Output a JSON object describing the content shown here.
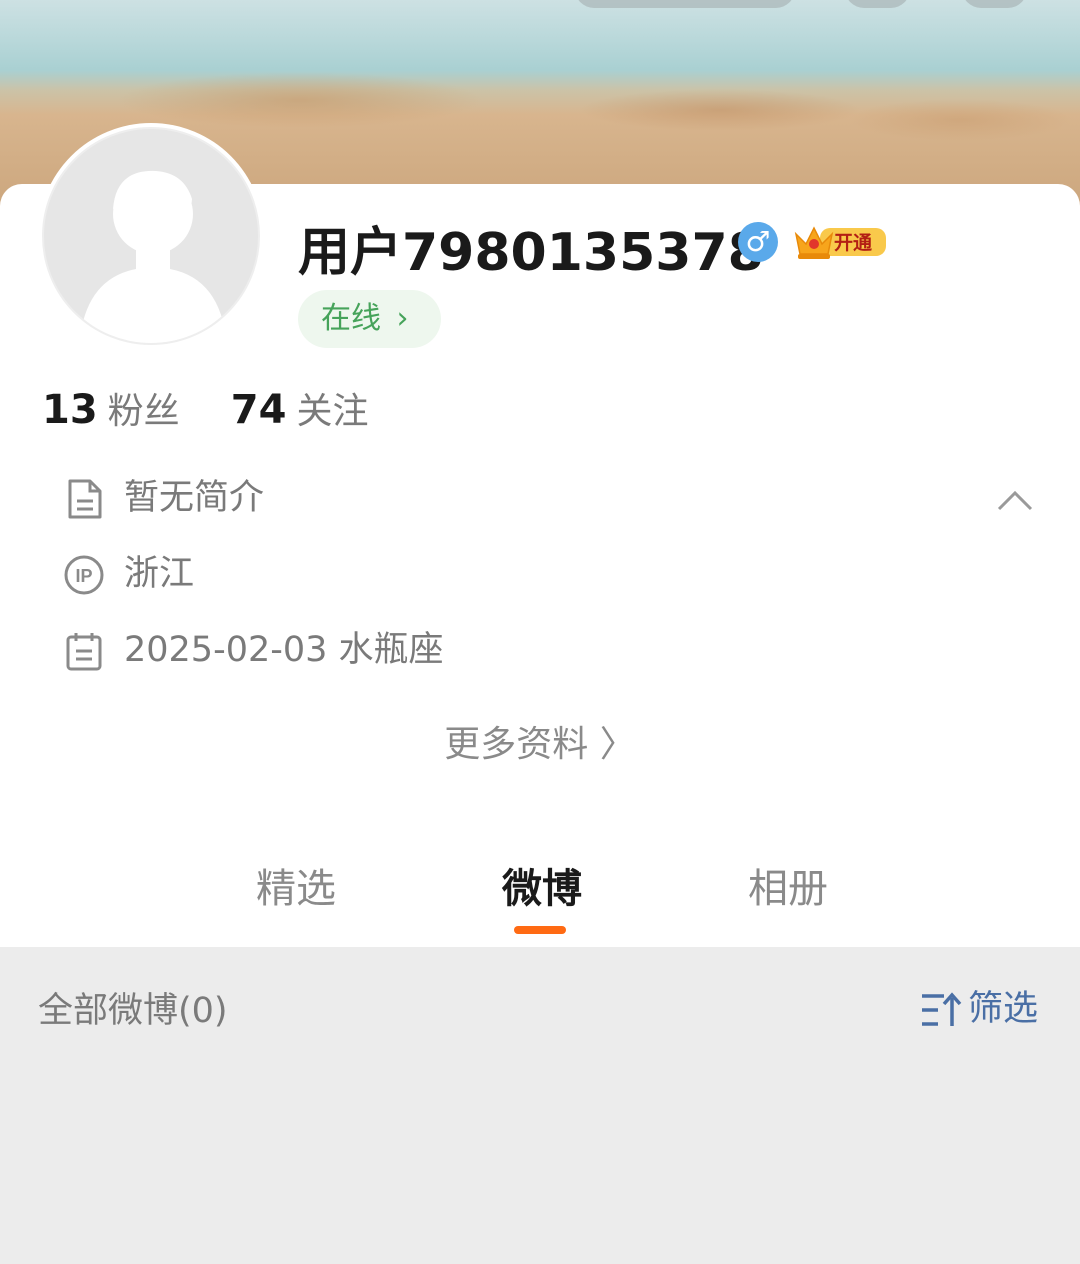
{
  "profile": {
    "username": "用户7980135378",
    "gender_symbol": "♂",
    "vip_badge": "开通",
    "online_status": "在线",
    "online_chevron": "›",
    "followers_count": "13",
    "followers_label": "粉丝",
    "following_count": "74",
    "following_label": "关注"
  },
  "info": {
    "bio": "暂无简介",
    "ip_location": "浙江",
    "birthday": "2025-02-03 水瓶座"
  },
  "more_info_label": "更多资料 〉",
  "tabs": [
    {
      "label": "精选",
      "active": false
    },
    {
      "label": "微博",
      "active": true
    },
    {
      "label": "相册",
      "active": false
    }
  ],
  "feed": {
    "header": "全部微博(0)",
    "filter_label": "筛选"
  },
  "colors": {
    "accent_tab": "#ff6a13",
    "online_green": "#46a35a",
    "filter_blue": "#4a6fa5",
    "gender_blue": "#5aa9ea"
  },
  "icons": [
    "document-icon",
    "ip-icon",
    "calendar-icon",
    "chevron-up-icon",
    "filter-icon",
    "crown-icon"
  ]
}
